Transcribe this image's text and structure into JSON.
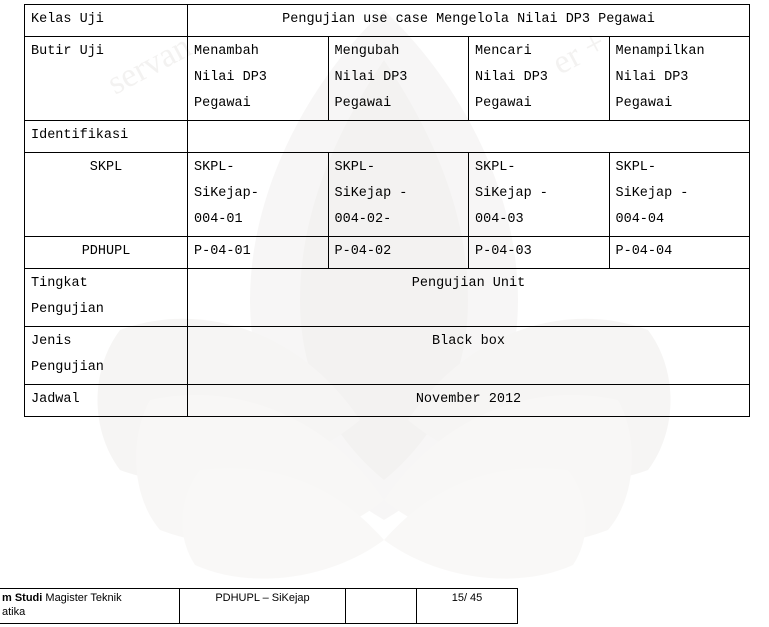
{
  "table": {
    "rows": [
      {
        "label": "Kelas Uji",
        "label_align": "left",
        "span_value": "Pengujian use case Mengelola Nilai DP3 Pegawai",
        "span": true
      },
      {
        "label": "Butir Uji",
        "label_align": "left",
        "cells": [
          [
            "Menambah",
            "Nilai DP3",
            "Pegawai"
          ],
          [
            "Mengubah",
            "Nilai DP3",
            "Pegawai"
          ],
          [
            "Mencari",
            "Nilai DP3",
            "Pegawai"
          ],
          [
            "Menampilkan",
            "Nilai DP3",
            "Pegawai"
          ]
        ]
      },
      {
        "label": "Identifikasi",
        "label_align": "left",
        "span_value": "",
        "span": true
      },
      {
        "label": "SKPL",
        "label_align": "center",
        "cells": [
          [
            "SKPL-",
            "SiKejap-",
            "004-01"
          ],
          [
            "SKPL-",
            "SiKejap -",
            "004-02-"
          ],
          [
            "SKPL-",
            "SiKejap -",
            "004-03"
          ],
          [
            "SKPL-",
            "SiKejap -",
            "004-04"
          ]
        ]
      },
      {
        "label": "PDHUPL",
        "label_align": "center",
        "cells": [
          [
            "P-04-01"
          ],
          [
            "P-04-02"
          ],
          [
            "P-04-03"
          ],
          [
            "P-04-04"
          ]
        ]
      },
      {
        "label_lines": [
          "Tingkat",
          "Pengujian"
        ],
        "label_align": "left",
        "span_value": "Pengujian Unit",
        "span": true
      },
      {
        "label_lines": [
          "Jenis",
          "Pengujian"
        ],
        "label_align": "left",
        "span_value": "Black box",
        "span": true
      },
      {
        "label": "Jadwal",
        "label_align": "left",
        "span_value": "November 2012",
        "span": true
      }
    ]
  },
  "footer": {
    "program_bold": "m Studi",
    "program_rest": " Magister Teknik",
    "program_line2": "atika",
    "document": "PDHUPL – SiKejap",
    "empty": "",
    "page": "15/ 45"
  },
  "watermark": {
    "text_left": "servan",
    "text_right": "er +"
  }
}
